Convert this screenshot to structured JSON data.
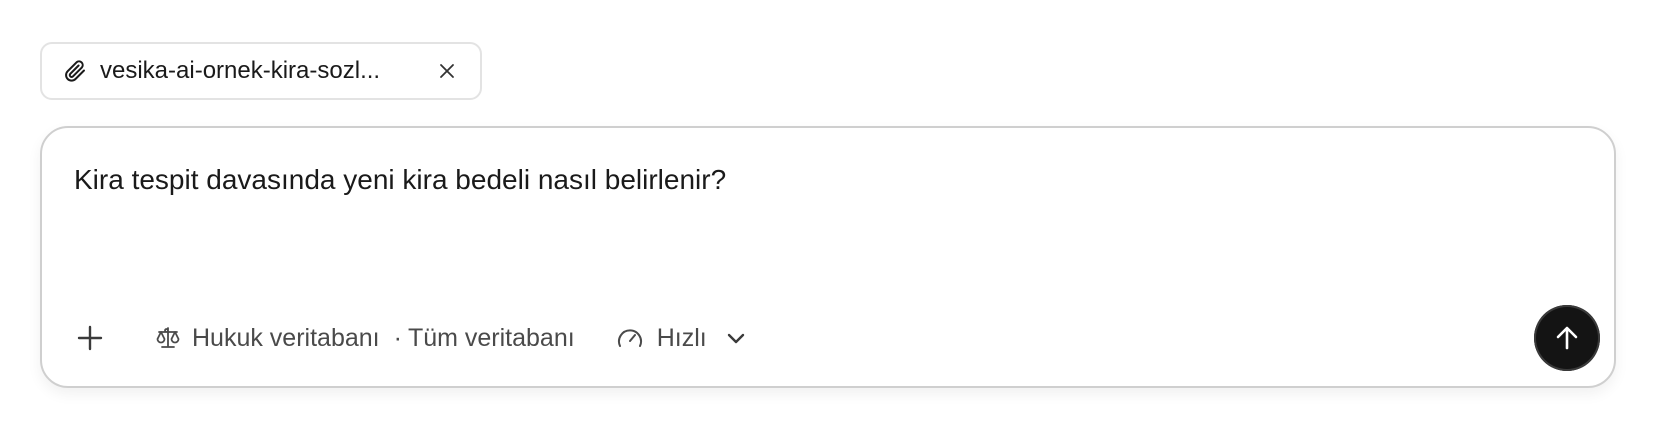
{
  "attachment": {
    "filename": "vesika-ai-ornek-kira-sozl...",
    "icon": "paperclip-icon",
    "remove_icon": "close-icon"
  },
  "composer": {
    "prompt_text": "Kira tespit davasında yeni kira bedeli nasıl belirlenir?",
    "toolbar": {
      "add_icon": "plus-icon",
      "database_icon": "scale-icon",
      "database_label": "Hukuk veritabanı",
      "database_separator": "·",
      "database_scope": "Tüm veritabanı",
      "speed_icon": "gauge-icon",
      "speed_label": "Hızlı",
      "speed_dropdown_icon": "chevron-down-icon",
      "send_icon": "arrow-up-icon"
    }
  },
  "colors": {
    "send_button_bg": "#141414",
    "border": "#cfcfcf",
    "muted_text": "#4a4a4a"
  }
}
